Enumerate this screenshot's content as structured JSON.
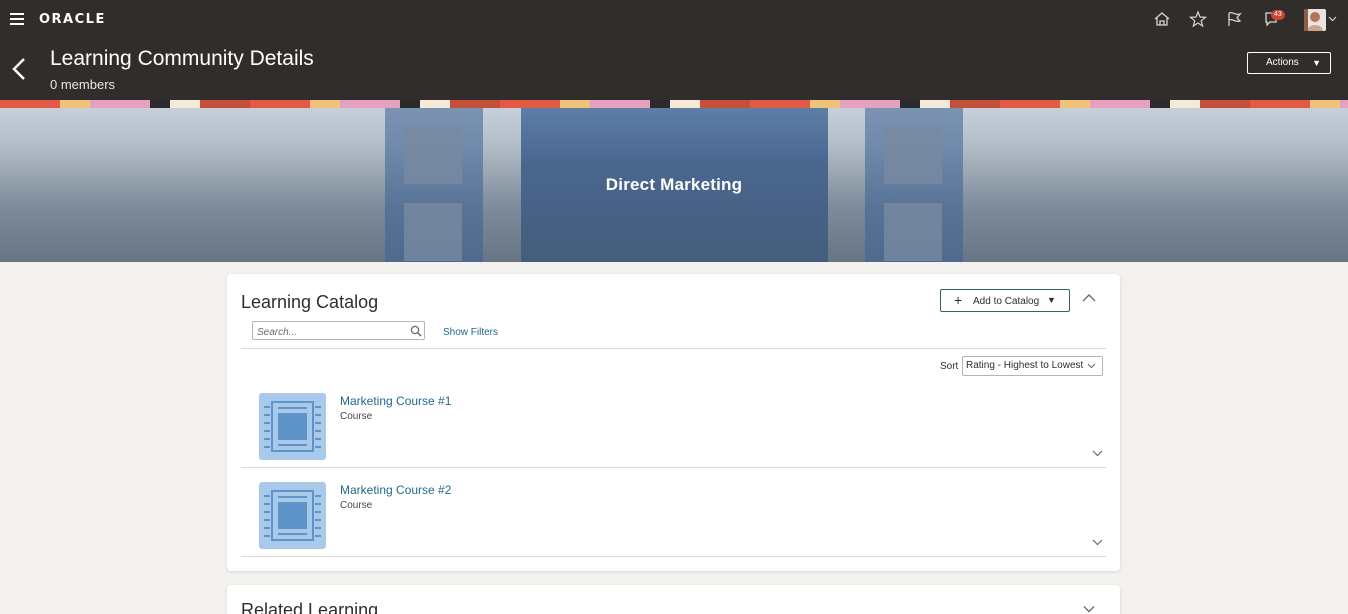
{
  "header": {
    "brand": "ORACLE",
    "title": "Learning Community Details",
    "subtitle": "0 members",
    "actions_label": "Actions",
    "notification_count": "43",
    "icons": [
      "menu-icon",
      "home-icon",
      "star-icon",
      "flag-icon",
      "notifications-icon",
      "user-avatar",
      "chevron-down-icon"
    ]
  },
  "banner": {
    "title": "Direct Marketing"
  },
  "catalog": {
    "title": "Learning Catalog",
    "add_label": "Add to Catalog",
    "search_placeholder": "Search...",
    "show_filters": "Show Filters",
    "sort_label": "Sort",
    "sort_value": "Rating - Highest to Lowest",
    "items": [
      {
        "title": "Marketing Course #1",
        "type": "Course"
      },
      {
        "title": "Marketing Course #2",
        "type": "Course"
      }
    ]
  },
  "related": {
    "title": "Related Learning"
  },
  "colors": {
    "header_bg": "#312d2a",
    "link": "#1e6a8a",
    "thumb": "#a9c9ea",
    "badge": "#c74634"
  }
}
